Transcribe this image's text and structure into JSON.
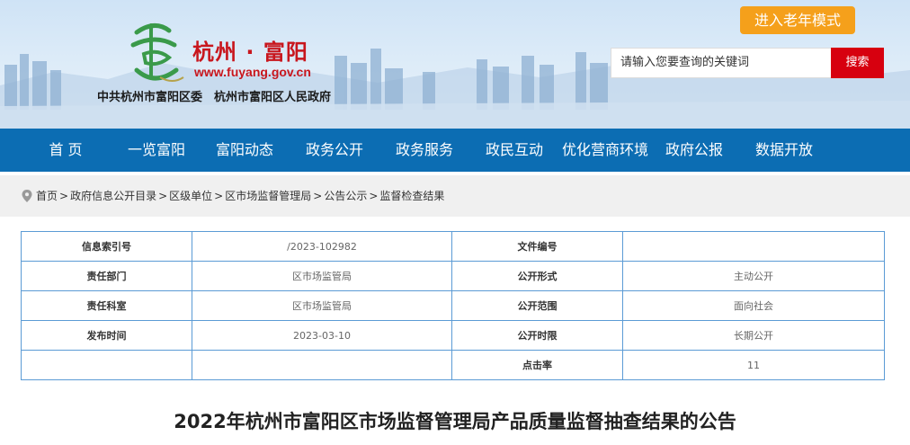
{
  "header": {
    "site_name": "杭州 · 富阳",
    "site_domain": "www.fuyang.gov.cn",
    "org_names": "中共杭州市富阳区委　杭州市富阳区人民政府",
    "elder_mode_label": "进入老年模式",
    "search": {
      "placeholder": "请输入您要查询的关键词",
      "button_label": "搜索"
    }
  },
  "nav": {
    "items": [
      {
        "label": "首 页"
      },
      {
        "label": "一览富阳"
      },
      {
        "label": "富阳动态"
      },
      {
        "label": "政务公开"
      },
      {
        "label": "政务服务"
      },
      {
        "label": "政民互动"
      },
      {
        "label": "优化营商环境"
      },
      {
        "label": "政府公报"
      },
      {
        "label": "数据开放"
      }
    ]
  },
  "breadcrumb": {
    "items": [
      {
        "label": "首页"
      },
      {
        "label": "政府信息公开目录"
      },
      {
        "label": "区级单位"
      },
      {
        "label": "区市场监督管理局"
      },
      {
        "label": "公告公示"
      },
      {
        "label": "监督检查结果"
      }
    ],
    "separator": ">"
  },
  "info_table": {
    "rows": [
      {
        "l1": "信息索引号",
        "v1": "/2023-102982",
        "l2": "文件编号",
        "v2": ""
      },
      {
        "l1": "责任部门",
        "v1": "区市场监管局",
        "l2": "公开形式",
        "v2": "主动公开"
      },
      {
        "l1": "责任科室",
        "v1": "区市场监管局",
        "l2": "公开范围",
        "v2": "面向社会"
      },
      {
        "l1": "发布时间",
        "v1": "2023-03-10",
        "l2": "公开时限",
        "v2": "长期公开"
      },
      {
        "l1": "",
        "v1": "",
        "l2": "点击率",
        "v2": "11"
      }
    ]
  },
  "article": {
    "title": "2022年杭州市富阳区市场监督管理局产品质量监督抽查结果的公告"
  },
  "colors": {
    "nav_bg": "#0c6db3",
    "brand_red": "#c8161d",
    "search_button": "#d7000f",
    "elder_button": "#f5a01b",
    "table_border": "#5b9bd5"
  }
}
